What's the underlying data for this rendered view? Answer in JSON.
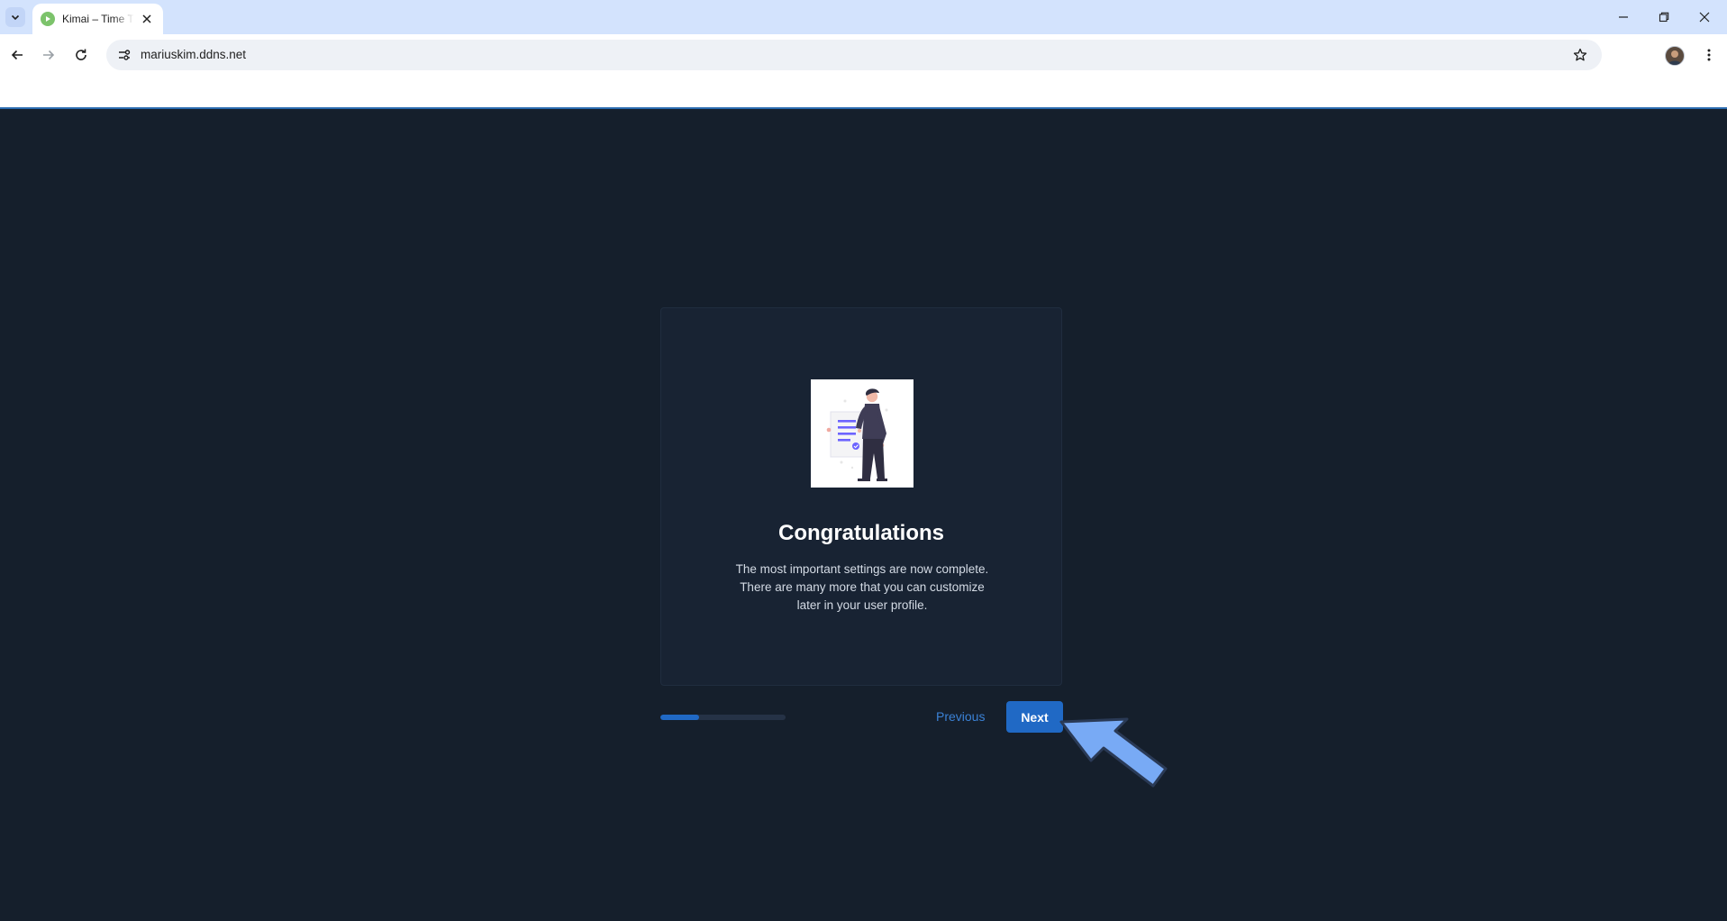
{
  "browser": {
    "tab": {
      "title": "Kimai – Time Tracking"
    },
    "address_bar": {
      "url": "mariuskim.ddns.net"
    }
  },
  "wizard": {
    "title": "Congratulations",
    "description": "The most important settings are now complete. There are many more that you can customize later in your user profile.",
    "progress": 0.31,
    "previous_label": "Previous",
    "next_label": "Next"
  },
  "colors": {
    "page_background": "#151f2c",
    "card_background": "#182333",
    "accent": "#2069c5",
    "link": "#3b82d6",
    "pointer_arrow": "#78aaf5"
  },
  "icons": [
    "chevron-down-icon",
    "kimai-favicon-icon",
    "close-icon",
    "minimize-icon",
    "restore-icon",
    "back-icon",
    "forward-icon",
    "reload-icon",
    "site-info-icon",
    "star-icon",
    "profile-avatar",
    "kebab-menu-icon",
    "pointer-arrow-icon"
  ]
}
